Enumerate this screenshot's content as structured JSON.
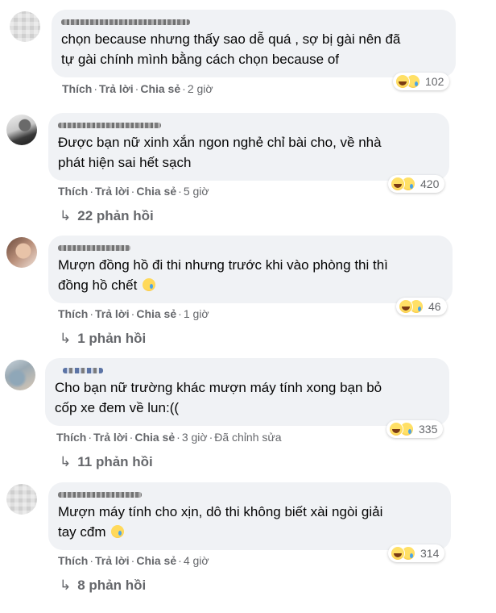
{
  "comments": [
    {
      "text_lines": [
        "chọn because nhưng thấy sao dễ quá , sợ bị gài nên đã",
        "tự gài chính mình bằng cách chọn because of"
      ],
      "actions": {
        "like": "Thích",
        "reply": "Trả lời",
        "share": "Chia sẻ",
        "time": "2 giờ",
        "edited": ""
      },
      "reactions": {
        "icons": [
          "haha-icon",
          "sad-icon"
        ],
        "count": "102"
      },
      "replies_label": ""
    },
    {
      "text_lines": [
        "Được bạn nữ xinh xắn ngon nghẻ chỉ bài cho, về nhà",
        "phát hiện sai hết sạch"
      ],
      "actions": {
        "like": "Thích",
        "reply": "Trả lời",
        "share": "Chia sẻ",
        "time": "5 giờ",
        "edited": ""
      },
      "reactions": {
        "icons": [
          "haha-icon",
          "sad-icon"
        ],
        "count": "420"
      },
      "replies_label": "22 phản hồi"
    },
    {
      "text_lines": [
        "Mượn đồng hồ đi thi nhưng trước khi vào phòng thi thì",
        "đồng hồ chết"
      ],
      "actions": {
        "like": "Thích",
        "reply": "Trả lời",
        "share": "Chia sẻ",
        "time": "1 giờ",
        "edited": ""
      },
      "reactions": {
        "icons": [
          "haha-icon",
          "sad-icon"
        ],
        "count": "46"
      },
      "replies_label": "1 phản hồi"
    },
    {
      "text_lines": [
        "Cho bạn nữ trường khác mượn máy tính xong bạn bỏ",
        "cốp xe đem về lun:(("
      ],
      "actions": {
        "like": "Thích",
        "reply": "Trả lời",
        "share": "Chia sẻ",
        "time": "3 giờ",
        "edited": "Đã chỉnh sửa"
      },
      "reactions": {
        "icons": [
          "haha-icon",
          "sad-icon"
        ],
        "count": "335"
      },
      "replies_label": "11 phản hồi"
    },
    {
      "text_lines": [
        "Mượn máy tính cho xịn, dô thi không biết xài ngòi giải",
        "tay cđm"
      ],
      "actions": {
        "like": "Thích",
        "reply": "Trả lời",
        "share": "Chia sẻ",
        "time": "4 giờ",
        "edited": ""
      },
      "reactions": {
        "icons": [
          "haha-icon",
          "sad-icon"
        ],
        "count": "314"
      },
      "replies_label": "8 phản hồi"
    }
  ],
  "colors": {
    "bubble": "#f0f2f5",
    "secondary_text": "#65676b",
    "text": "#050505"
  }
}
